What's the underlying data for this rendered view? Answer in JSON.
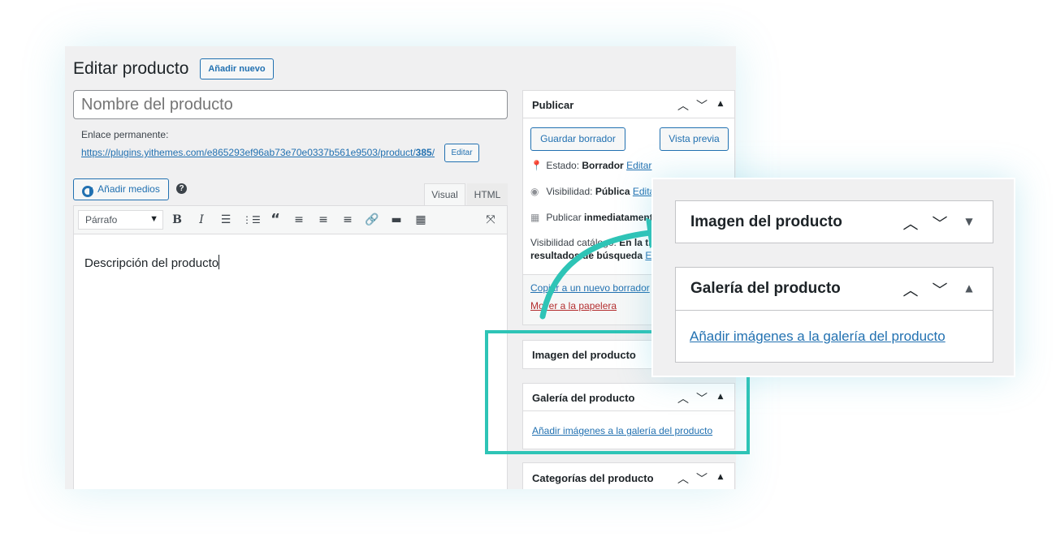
{
  "page": {
    "title": "Editar producto",
    "add_new": "Añadir nuevo"
  },
  "editor": {
    "title_placeholder": "Nombre del producto",
    "permalink_label": "Enlace permanente:",
    "permalink_url_prefix": "https://plugins.yithemes.com/e865293ef96ab73e70e0337b561e9503/product/",
    "permalink_slug": "385",
    "permalink_suffix": "/",
    "edit_slug": "Editar",
    "add_media": "Añadir medios",
    "help": "?",
    "tab_visual": "Visual",
    "tab_html": "HTML",
    "format_select": "Párrafo",
    "content": "Descripción del producto",
    "toolbar_icons": [
      "bold-icon",
      "italic-icon",
      "bullet-list-icon",
      "numbered-list-icon",
      "blockquote-icon",
      "align-left-icon",
      "align-center-icon",
      "align-right-icon",
      "link-icon",
      "read-more-icon",
      "toolbar-toggle-icon",
      "fullscreen-icon"
    ]
  },
  "publish": {
    "title": "Publicar",
    "save_draft": "Guardar borrador",
    "preview": "Vista previa",
    "status_label": "Estado:",
    "status_value": "Borrador",
    "status_edit": "Editar",
    "visibility_label": "Visibilidad:",
    "visibility_value": "Pública",
    "visibility_edit": "Editar",
    "publish_label": "Publicar",
    "publish_value": "inmediatamente",
    "catalog_label": "Visibilidad catálogo:",
    "catalog_value_1": "En la tienda y en los",
    "catalog_value_2": "resultados de búsqueda",
    "catalog_edit": "Editar",
    "copy_draft": "Copiar a un nuevo borrador",
    "trash": "Mover a la papelera"
  },
  "product_image": {
    "title": "Imagen del producto"
  },
  "gallery": {
    "title": "Galería del producto",
    "add_link": "Añadir imágenes a la galería del producto"
  },
  "categories": {
    "title": "Categorías del producto"
  },
  "colors": {
    "accent": "#2271b1",
    "highlight": "#2ec4b6",
    "trash": "#b32d2e"
  }
}
